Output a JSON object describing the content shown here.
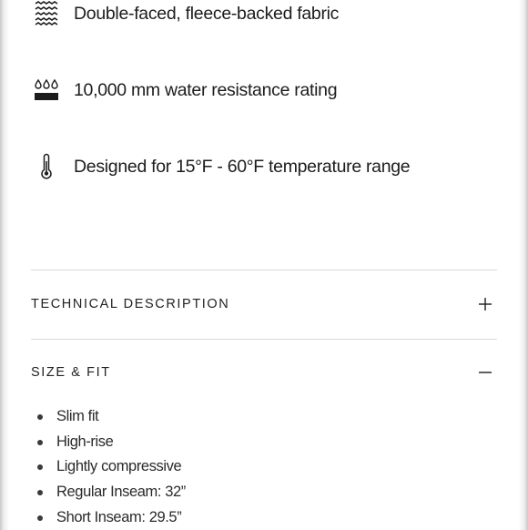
{
  "features": [
    {
      "icon": "fabric-waves-icon",
      "text": "Double-faced, fleece-backed fabric"
    },
    {
      "icon": "water-drops-icon",
      "text": "10,000 mm water resistance rating"
    },
    {
      "icon": "thermometer-icon",
      "text": "Designed for 15°F - 60°F temperature range"
    }
  ],
  "accordion": {
    "technical": {
      "title": "TECHNICAL DESCRIPTION",
      "state": "collapsed",
      "toggle_icon": "plus-icon"
    },
    "size_fit": {
      "title": "SIZE & FIT",
      "state": "expanded",
      "toggle_icon": "minus-icon",
      "items": [
        "Slim fit",
        "High-rise",
        "Lightly compressive",
        "Regular Inseam: 32”",
        "Short Inseam: 29.5”"
      ]
    }
  },
  "colors": {
    "text": "#1c1c1c",
    "divider": "#d8d8d8",
    "background": "#ffffff"
  }
}
